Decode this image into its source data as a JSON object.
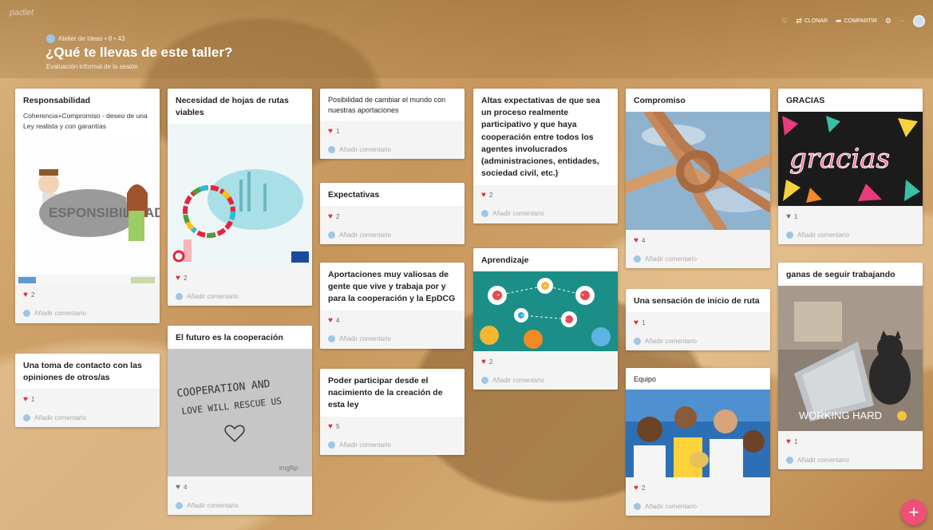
{
  "app": {
    "brand": "padlet"
  },
  "header": {
    "meta": "Atelier de Ideas • 8 • 43",
    "title": "¿Qué te llevas de este taller?",
    "subtitle": "Evaluación informal de la sesión"
  },
  "actions": {
    "clone": "CLONAR",
    "share": "COMPARTIR",
    "more": "···"
  },
  "comment_placeholder": "Añadir comentario",
  "image_text": {
    "responsabilidad": "ESPONSIBILIDAD",
    "cooperation_line1": "COOPERATION AND",
    "cooperation_line2": "LOVE WILL RESCUE US",
    "imgflip": "imgflip",
    "gracias": "gracias",
    "working": "WORKING HARD"
  },
  "cards": {
    "c1": {
      "title": "Responsabilidad",
      "body": "Coherencia+Compromiso - deseo de una Ley realista y con garantías",
      "likes": "2"
    },
    "c2": {
      "title": "Una toma de contacto con las opiniones de otros/as",
      "likes": "1"
    },
    "c3": {
      "title": "Necesidad de hojas de rutas viables",
      "likes": "2"
    },
    "c4": {
      "title": "El futuro es la cooperación",
      "likes": "4"
    },
    "c5": {
      "title": "Posibilidad de cambiar el mundo con nuestras aportaciones",
      "likes": "1"
    },
    "c6": {
      "title": "Expectativas",
      "likes": "2"
    },
    "c7": {
      "title": "Aportaciones muy valiosas de gente que vive y trabaja por y para la cooperación y la EpDCG",
      "likes": "4"
    },
    "c8": {
      "title": "Poder participar desde el nacimiento de la creación de esta ley",
      "likes": "5"
    },
    "c9": {
      "title": "Altas expectativas de que sea un proceso realmente participativo y que haya cooperación entre todos los agentes involucrados (administraciones, entidades, sociedad civil, etc.)",
      "likes": "2"
    },
    "c10": {
      "title": "Aprendizaje",
      "likes": "2"
    },
    "c11": {
      "title": "Compromiso",
      "likes": "4"
    },
    "c12": {
      "title": "Una sensación de inicio de ruta",
      "likes": "1"
    },
    "c13": {
      "title": "Equipo",
      "likes": "2"
    },
    "c14": {
      "title": "GRACIAS",
      "likes": "1"
    },
    "c15": {
      "title": "ganas de seguir trabajando",
      "likes": "1"
    }
  },
  "colors": {
    "heart": "#d8353a",
    "fab": "#ef4f78"
  },
  "fab": {
    "label": "+"
  }
}
